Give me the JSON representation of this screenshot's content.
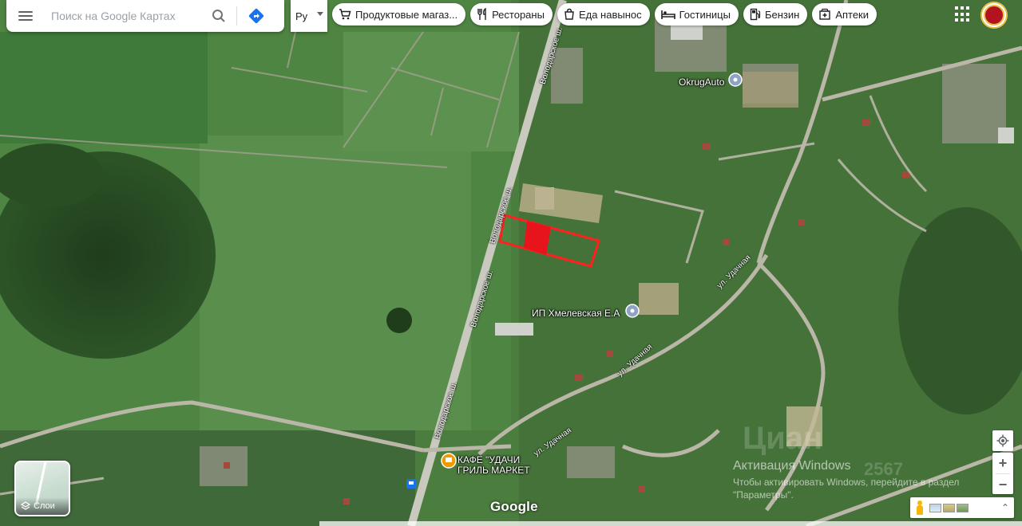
{
  "search": {
    "placeholder": "Поиск на Google Картах"
  },
  "language": {
    "selected": "Ру"
  },
  "chips": [
    {
      "label": "Продуктовые магаз...",
      "icon": "cart-icon"
    },
    {
      "label": "Рестораны",
      "icon": "fork-knife-icon"
    },
    {
      "label": "Еда навынос",
      "icon": "takeout-bag-icon"
    },
    {
      "label": "Гостиницы",
      "icon": "bed-icon"
    },
    {
      "label": "Бензин",
      "icon": "fuel-pump-icon"
    },
    {
      "label": "Аптеки",
      "icon": "pharmacy-icon"
    }
  ],
  "map": {
    "labels": {
      "okrugauto": "OkrugAuto",
      "khmelevskaya": "ИП Хмелевская Е.А",
      "cafe_line1": "КАФЕ \"УДАЧИ",
      "cafe_line2": "ГРИЛЬ МАРКЕТ"
    },
    "roads": {
      "volodarskoe_1": "Володарское ш.",
      "volodarskoe_2": "Володарское ш.",
      "volodarskoe_3": "Володарское ш.",
      "udachnaya_1": "ул. Удачная",
      "udachnaya_2": "ул. Удачная",
      "udachnaya_3": "ул. Удачная"
    },
    "colors": {
      "parcel_outline": "#ff2020",
      "parcel_fill": "#e8141c",
      "place_pin": "#8fa4c4",
      "food_pin": "#f29900"
    }
  },
  "layers": {
    "label": "Слои"
  },
  "brand": {
    "logo": "Google"
  },
  "controls": {
    "zoom_in": "+",
    "zoom_out": "−",
    "expand": "⌃"
  },
  "windows_activation": {
    "title": "Активация Windows",
    "line1": "Чтобы активировать Windows, перейдите в раздел",
    "line2": "\"Параметры\"."
  },
  "watermark": {
    "brand": "Циан",
    "id": "2567"
  }
}
